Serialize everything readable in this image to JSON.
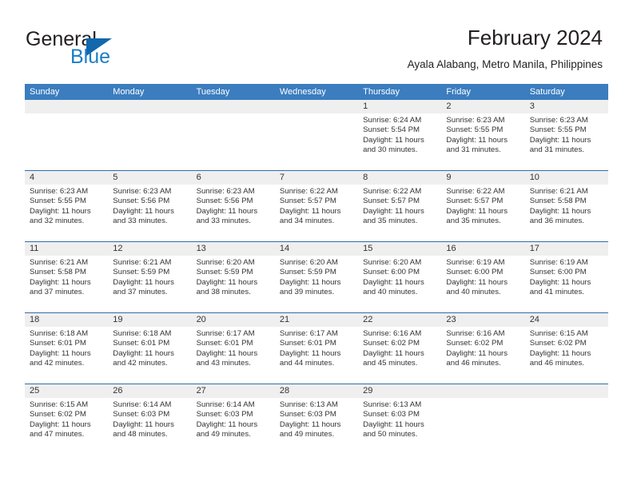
{
  "brand": {
    "name_part1": "General",
    "name_part2": "Blue",
    "logo_icon": "blue-triangle-logo"
  },
  "header": {
    "title": "February 2024",
    "location": "Ayala Alabang, Metro Manila, Philippines"
  },
  "colors": {
    "header_blue": "#3b7dbf",
    "week_divider": "#2f6fa8",
    "daynum_band": "#efefef",
    "brand_blue": "#1d7ec6",
    "logo_blue": "#1267ad",
    "text": "#333333"
  },
  "calendar": {
    "weekdays": [
      "Sunday",
      "Monday",
      "Tuesday",
      "Wednesday",
      "Thursday",
      "Friday",
      "Saturday"
    ],
    "weeks": [
      [
        {
          "day": "",
          "lines": []
        },
        {
          "day": "",
          "lines": []
        },
        {
          "day": "",
          "lines": []
        },
        {
          "day": "",
          "lines": []
        },
        {
          "day": "1",
          "lines": [
            "Sunrise: 6:24 AM",
            "Sunset: 5:54 PM",
            "Daylight: 11 hours",
            "and 30 minutes."
          ]
        },
        {
          "day": "2",
          "lines": [
            "Sunrise: 6:23 AM",
            "Sunset: 5:55 PM",
            "Daylight: 11 hours",
            "and 31 minutes."
          ]
        },
        {
          "day": "3",
          "lines": [
            "Sunrise: 6:23 AM",
            "Sunset: 5:55 PM",
            "Daylight: 11 hours",
            "and 31 minutes."
          ]
        }
      ],
      [
        {
          "day": "4",
          "lines": [
            "Sunrise: 6:23 AM",
            "Sunset: 5:55 PM",
            "Daylight: 11 hours",
            "and 32 minutes."
          ]
        },
        {
          "day": "5",
          "lines": [
            "Sunrise: 6:23 AM",
            "Sunset: 5:56 PM",
            "Daylight: 11 hours",
            "and 33 minutes."
          ]
        },
        {
          "day": "6",
          "lines": [
            "Sunrise: 6:23 AM",
            "Sunset: 5:56 PM",
            "Daylight: 11 hours",
            "and 33 minutes."
          ]
        },
        {
          "day": "7",
          "lines": [
            "Sunrise: 6:22 AM",
            "Sunset: 5:57 PM",
            "Daylight: 11 hours",
            "and 34 minutes."
          ]
        },
        {
          "day": "8",
          "lines": [
            "Sunrise: 6:22 AM",
            "Sunset: 5:57 PM",
            "Daylight: 11 hours",
            "and 35 minutes."
          ]
        },
        {
          "day": "9",
          "lines": [
            "Sunrise: 6:22 AM",
            "Sunset: 5:57 PM",
            "Daylight: 11 hours",
            "and 35 minutes."
          ]
        },
        {
          "day": "10",
          "lines": [
            "Sunrise: 6:21 AM",
            "Sunset: 5:58 PM",
            "Daylight: 11 hours",
            "and 36 minutes."
          ]
        }
      ],
      [
        {
          "day": "11",
          "lines": [
            "Sunrise: 6:21 AM",
            "Sunset: 5:58 PM",
            "Daylight: 11 hours",
            "and 37 minutes."
          ]
        },
        {
          "day": "12",
          "lines": [
            "Sunrise: 6:21 AM",
            "Sunset: 5:59 PM",
            "Daylight: 11 hours",
            "and 37 minutes."
          ]
        },
        {
          "day": "13",
          "lines": [
            "Sunrise: 6:20 AM",
            "Sunset: 5:59 PM",
            "Daylight: 11 hours",
            "and 38 minutes."
          ]
        },
        {
          "day": "14",
          "lines": [
            "Sunrise: 6:20 AM",
            "Sunset: 5:59 PM",
            "Daylight: 11 hours",
            "and 39 minutes."
          ]
        },
        {
          "day": "15",
          "lines": [
            "Sunrise: 6:20 AM",
            "Sunset: 6:00 PM",
            "Daylight: 11 hours",
            "and 40 minutes."
          ]
        },
        {
          "day": "16",
          "lines": [
            "Sunrise: 6:19 AM",
            "Sunset: 6:00 PM",
            "Daylight: 11 hours",
            "and 40 minutes."
          ]
        },
        {
          "day": "17",
          "lines": [
            "Sunrise: 6:19 AM",
            "Sunset: 6:00 PM",
            "Daylight: 11 hours",
            "and 41 minutes."
          ]
        }
      ],
      [
        {
          "day": "18",
          "lines": [
            "Sunrise: 6:18 AM",
            "Sunset: 6:01 PM",
            "Daylight: 11 hours",
            "and 42 minutes."
          ]
        },
        {
          "day": "19",
          "lines": [
            "Sunrise: 6:18 AM",
            "Sunset: 6:01 PM",
            "Daylight: 11 hours",
            "and 42 minutes."
          ]
        },
        {
          "day": "20",
          "lines": [
            "Sunrise: 6:17 AM",
            "Sunset: 6:01 PM",
            "Daylight: 11 hours",
            "and 43 minutes."
          ]
        },
        {
          "day": "21",
          "lines": [
            "Sunrise: 6:17 AM",
            "Sunset: 6:01 PM",
            "Daylight: 11 hours",
            "and 44 minutes."
          ]
        },
        {
          "day": "22",
          "lines": [
            "Sunrise: 6:16 AM",
            "Sunset: 6:02 PM",
            "Daylight: 11 hours",
            "and 45 minutes."
          ]
        },
        {
          "day": "23",
          "lines": [
            "Sunrise: 6:16 AM",
            "Sunset: 6:02 PM",
            "Daylight: 11 hours",
            "and 46 minutes."
          ]
        },
        {
          "day": "24",
          "lines": [
            "Sunrise: 6:15 AM",
            "Sunset: 6:02 PM",
            "Daylight: 11 hours",
            "and 46 minutes."
          ]
        }
      ],
      [
        {
          "day": "25",
          "lines": [
            "Sunrise: 6:15 AM",
            "Sunset: 6:02 PM",
            "Daylight: 11 hours",
            "and 47 minutes."
          ]
        },
        {
          "day": "26",
          "lines": [
            "Sunrise: 6:14 AM",
            "Sunset: 6:03 PM",
            "Daylight: 11 hours",
            "and 48 minutes."
          ]
        },
        {
          "day": "27",
          "lines": [
            "Sunrise: 6:14 AM",
            "Sunset: 6:03 PM",
            "Daylight: 11 hours",
            "and 49 minutes."
          ]
        },
        {
          "day": "28",
          "lines": [
            "Sunrise: 6:13 AM",
            "Sunset: 6:03 PM",
            "Daylight: 11 hours",
            "and 49 minutes."
          ]
        },
        {
          "day": "29",
          "lines": [
            "Sunrise: 6:13 AM",
            "Sunset: 6:03 PM",
            "Daylight: 11 hours",
            "and 50 minutes."
          ]
        },
        {
          "day": "",
          "lines": []
        },
        {
          "day": "",
          "lines": []
        }
      ]
    ]
  }
}
